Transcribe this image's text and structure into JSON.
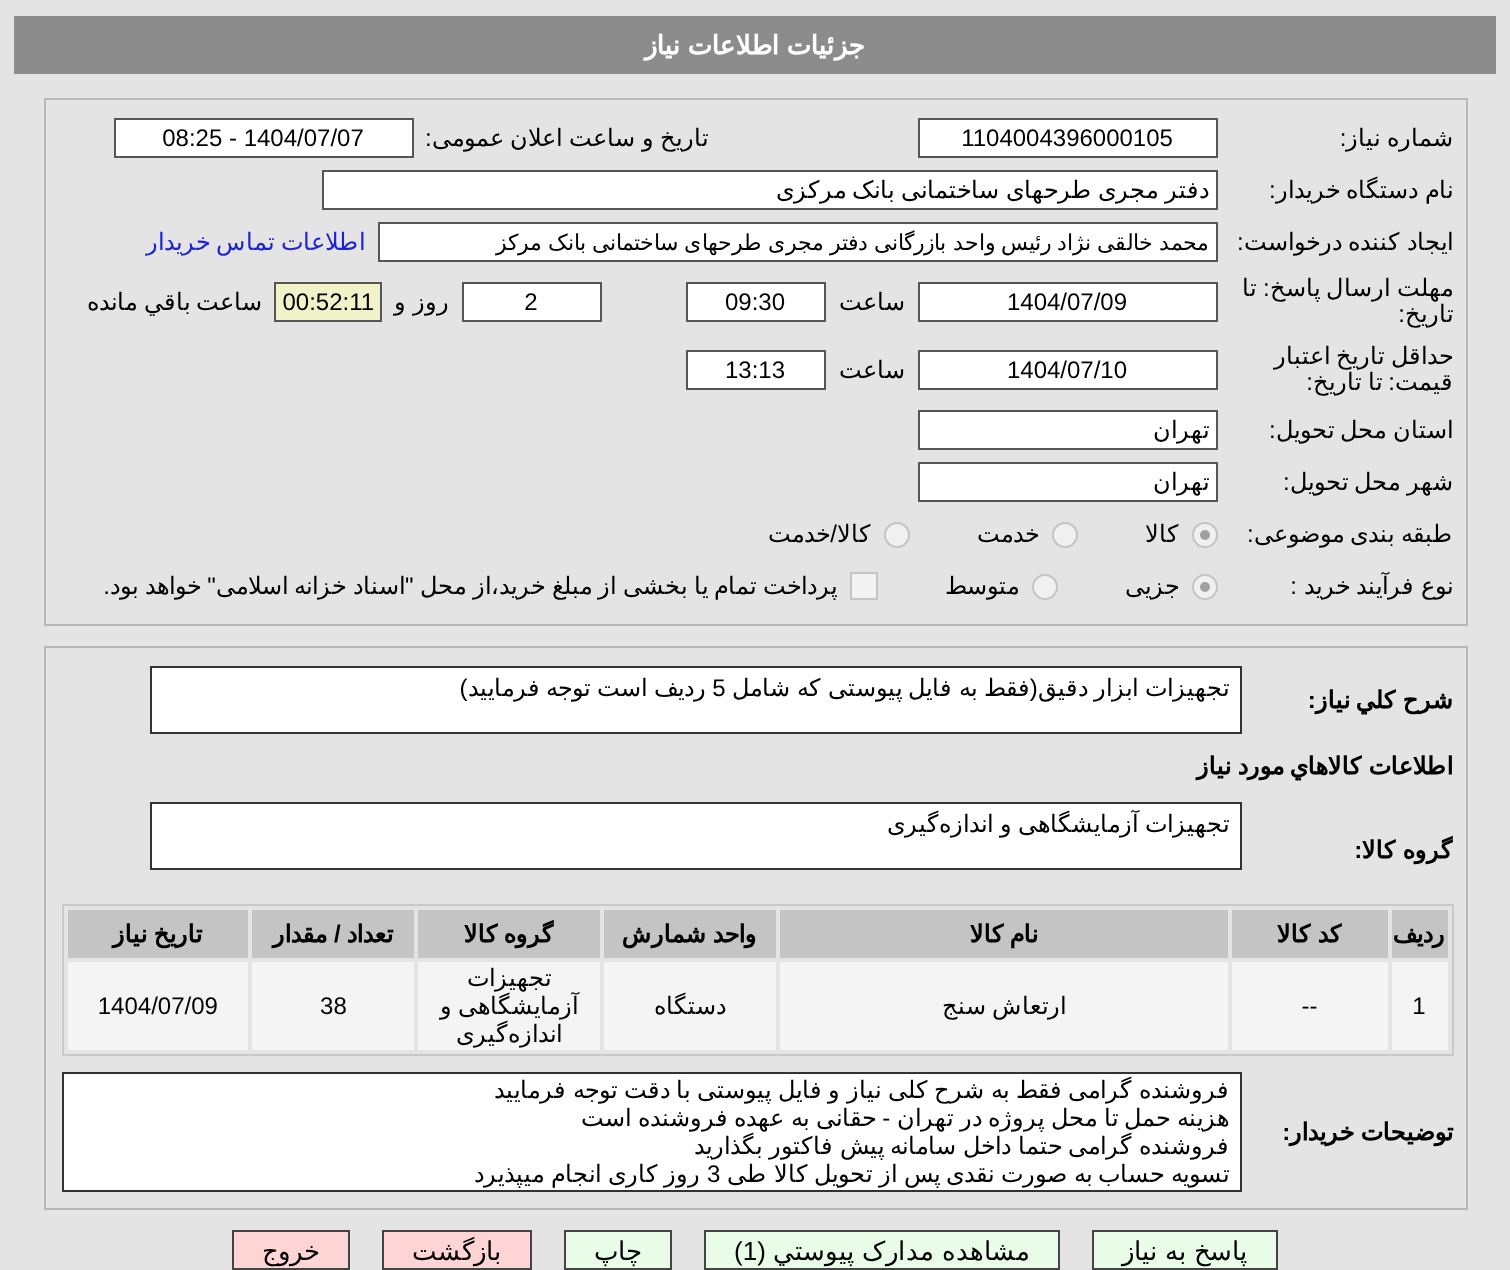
{
  "header": {
    "title": "جزئیات اطلاعات نیاز"
  },
  "need_number": {
    "label": "شماره نیاز:",
    "value": "1104004396000105"
  },
  "announce": {
    "label": "تاریخ و ساعت اعلان عمومی:",
    "value": "1404/07/07 - 08:25"
  },
  "buyer_org": {
    "label": "نام دستگاه خریدار:",
    "value": "دفتر مجری طرحهای ساختمانی بانک مرکزی"
  },
  "requester": {
    "label": "ایجاد کننده درخواست:",
    "value": "محمد خالقی نژاد رئیس واحد بازرگانی دفتر مجری طرحهای ساختمانی بانک مرکز",
    "link": "اطلاعات تماس خریدار"
  },
  "deadline": {
    "label": "مهلت ارسال پاسخ: تا تاریخ:",
    "date": "1404/07/09",
    "time_label": "ساعت",
    "time": "09:30",
    "days": "2",
    "days_label": "روز و",
    "remaining": "00:52:11",
    "remaining_label": "ساعت باقي مانده"
  },
  "validity": {
    "label": "حداقل تاریخ اعتبار قیمت: تا تاریخ:",
    "date": "1404/07/10",
    "time_label": "ساعت",
    "time": "13:13"
  },
  "province": {
    "label": "استان محل تحویل:",
    "value": "تهران"
  },
  "city": {
    "label": "شهر محل تحویل:",
    "value": "تهران"
  },
  "category": {
    "label": "طبقه بندی موضوعی:",
    "options": [
      {
        "label": "کالا",
        "selected": true
      },
      {
        "label": "خدمت",
        "selected": false
      },
      {
        "label": "کالا/خدمت",
        "selected": false
      }
    ]
  },
  "process": {
    "label": "نوع فرآیند خرید :",
    "options": [
      {
        "label": "جزیی",
        "selected": true
      },
      {
        "label": "متوسط",
        "selected": false
      }
    ],
    "checkbox": {
      "label": "پرداخت تمام یا بخشی از مبلغ خرید،از محل \"اسناد خزانه اسلامی\" خواهد بود.",
      "checked": false
    }
  },
  "description": {
    "label": "شرح کلي نياز:",
    "value": "تجهیزات ابزار دقیق(فقط به فایل پیوستی که شامل 5 ردیف است توجه فرمایید)"
  },
  "goods_title": "اطلاعات کالاهاي مورد نياز",
  "goods_group": {
    "label": "گروه کالا:",
    "value": "تجهیزات آزمایشگاهی و اندازه‌گیری"
  },
  "table": {
    "columns": [
      "ردیف",
      "کد کالا",
      "نام کالا",
      "واحد شمارش",
      "گروه کالا",
      "تعداد / مقدار",
      "تاریخ نیاز"
    ],
    "rows": [
      [
        "1",
        "--",
        "ارتعاش سنج",
        "دستگاه",
        "تجهیزات آزمایشگاهی و اندازه‌گیری",
        "38",
        "1404/07/09"
      ]
    ]
  },
  "buyer_notes": {
    "label": "توضیحات خریدار:",
    "lines": [
      "فروشنده گرامی فقط به شرح کلی نیاز و فایل پیوستی با دقت توجه فرمایید",
      "هزینه حمل تا محل پروژه در تهران - حقانی به عهده فروشنده است",
      "فروشنده گرامی حتما داخل سامانه پیش فاکتور بگذارید",
      "تسویه حساب به صورت نقدی پس از تحویل کالا طی 3 روز کاری انجام میپذیرد"
    ]
  },
  "buttons": [
    {
      "label": "پاسخ به نیاز",
      "kind": "green"
    },
    {
      "label": "مشاهده مدارک پیوستي (1)",
      "kind": "green"
    },
    {
      "label": "چاپ",
      "kind": "green"
    },
    {
      "label": "بازگشت",
      "kind": "red"
    },
    {
      "label": "خروج",
      "kind": "red"
    }
  ]
}
